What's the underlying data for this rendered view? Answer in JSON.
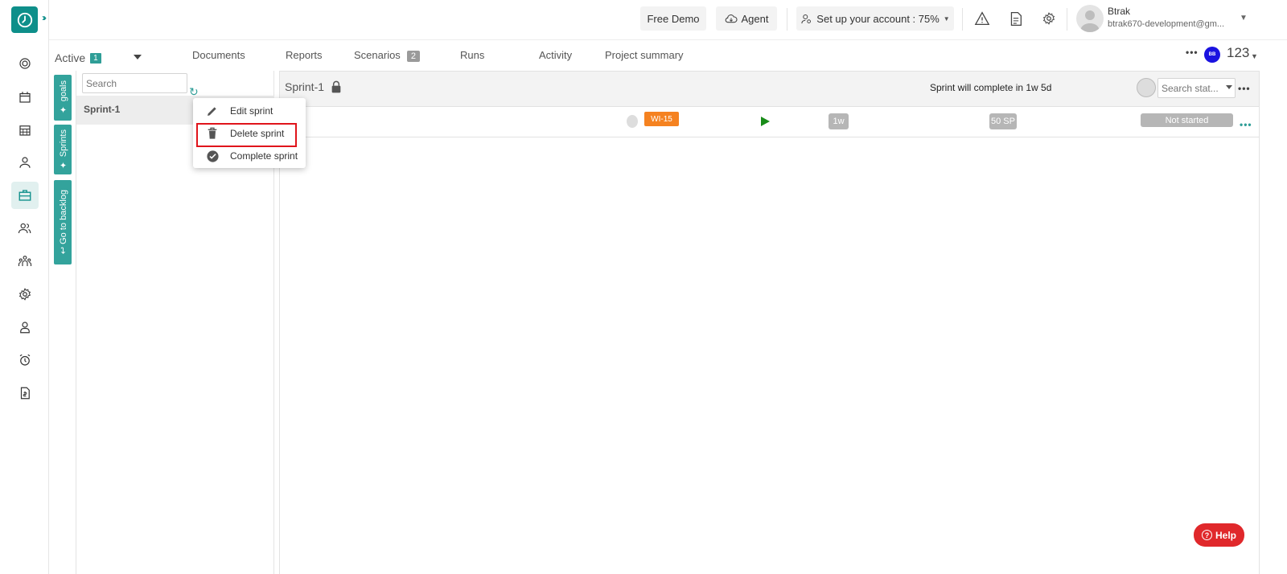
{
  "topbar": {
    "free_demo": "Free Demo",
    "agent": "Agent",
    "setup": "Set up your account : 75%",
    "user_name": "Btrak",
    "user_email": "btrak670-development@gm..."
  },
  "tabs_row": {
    "active_label": "Active",
    "active_count": "1",
    "tabs": [
      "Documents",
      "Reports",
      "Scenarios",
      "Runs",
      "Activity",
      "Project summary"
    ],
    "scenarios_count": "2",
    "project_initials": "BB",
    "project_number": "123"
  },
  "side_tabs": [
    "goals",
    "Sprints",
    "Go to backlog"
  ],
  "sprint_list": {
    "search_placeholder": "Search",
    "items": [
      "Sprint-1"
    ]
  },
  "context_menu": {
    "items": [
      "Edit sprint",
      "Delete sprint",
      "Complete sprint"
    ],
    "highlighted": "Delete sprint",
    "highlight_color": "#e0141b"
  },
  "main": {
    "title": "Sprint-1",
    "completion_text": "Sprint will complete in 1w 5d",
    "status_search_placeholder": "Search stat...",
    "row": {
      "work_item": "WI-15",
      "duration": "1w",
      "story_points": "50 SP",
      "status": "Not started"
    }
  },
  "help": {
    "label": "Help",
    "color": "#e0282b"
  },
  "colors": {
    "accent": "#0e8f8a",
    "work_item_badge": "#f58220",
    "play": "#198c19"
  },
  "icons": [
    "clock-logo-icon",
    "dashboard-icon",
    "calendar-icon",
    "calendar-grid-icon",
    "user-icon",
    "briefcase-icon",
    "users-icon",
    "team-icon",
    "gear-icon",
    "profile-icon",
    "alarm-icon",
    "invoice-icon",
    "cloud-icon",
    "person-cog-icon",
    "warning-icon",
    "document-icon",
    "settings-icon",
    "lock-icon",
    "pencil-icon",
    "trash-icon",
    "check-circle-icon",
    "refresh-icon",
    "pin-icon"
  ]
}
